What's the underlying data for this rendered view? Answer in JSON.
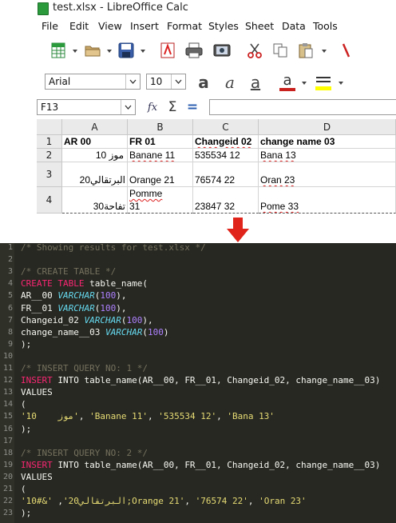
{
  "window": {
    "title": "test.xlsx - LibreOffice Calc"
  },
  "menu": [
    "File",
    "Edit",
    "View",
    "Insert",
    "Format",
    "Styles",
    "Sheet",
    "Data",
    "Tools"
  ],
  "toolbar": {
    "font_name": "Arial",
    "font_size": "10"
  },
  "formula_bar": {
    "cell_ref": "F13",
    "content": ""
  },
  "sheet": {
    "columns": [
      "A",
      "B",
      "C",
      "D"
    ],
    "rows": [
      "1",
      "2",
      "3",
      "4"
    ],
    "cells": {
      "A1": "AR  00",
      "B1": "FR  01",
      "C1": "Changeid 02",
      "D1": "change name  03",
      "A2": "موز  10",
      "B2": "Banane 11",
      "C2": "535534 12",
      "D2": "Bana 13",
      "A3": "البرتقالي20",
      "B3": "Orange 21",
      "C3": "76574 22",
      "D3": "Oran 23",
      "A4": "تفاحة30",
      "B4a": "Pomme",
      "B4b": "31",
      "C4": "23847 32",
      "D4": "Pome 33"
    }
  },
  "arrow_color": "#e0241b",
  "code_lines": [
    [
      {
        "t": "/* Showing results for test.xlsx */",
        "c": "cm"
      }
    ],
    [],
    [
      {
        "t": "/* CREATE TABLE */",
        "c": "cm"
      }
    ],
    [
      {
        "t": "CREATE TABLE",
        "c": "kw"
      },
      {
        "t": " table_name("
      }
    ],
    [
      {
        "t": "AR__00 "
      },
      {
        "t": "VARCHAR",
        "c": "ty"
      },
      {
        "t": "("
      },
      {
        "t": "100",
        "c": "nm"
      },
      {
        "t": "),"
      }
    ],
    [
      {
        "t": "FR__01 "
      },
      {
        "t": "VARCHAR",
        "c": "ty"
      },
      {
        "t": "("
      },
      {
        "t": "100",
        "c": "nm"
      },
      {
        "t": "),"
      }
    ],
    [
      {
        "t": "Changeid_02 "
      },
      {
        "t": "VARCHAR",
        "c": "ty"
      },
      {
        "t": "("
      },
      {
        "t": "100",
        "c": "nm"
      },
      {
        "t": "),"
      }
    ],
    [
      {
        "t": "change_name__03 "
      },
      {
        "t": "VARCHAR",
        "c": "ty"
      },
      {
        "t": "("
      },
      {
        "t": "100",
        "c": "nm"
      },
      {
        "t": ")"
      }
    ],
    [
      {
        "t": ");"
      }
    ],
    [],
    [
      {
        "t": "/* INSERT QUERY NO: 1 */",
        "c": "cm"
      }
    ],
    [
      {
        "t": "INSERT",
        "c": "kw"
      },
      {
        "t": " INTO table_name(AR__00, FR__01, Changeid_02, change_name__03)"
      }
    ],
    [
      {
        "t": "VALUES"
      }
    ],
    [
      {
        "t": "("
      }
    ],
    [
      {
        "t": "'10    موز'",
        "c": "st"
      },
      {
        "t": ", "
      },
      {
        "t": "'Banane 11'",
        "c": "st"
      },
      {
        "t": ", "
      },
      {
        "t": "'535534 12'",
        "c": "st"
      },
      {
        "t": ", "
      },
      {
        "t": "'Bana 13'",
        "c": "st"
      }
    ],
    [
      {
        "t": ");"
      }
    ],
    [],
    [
      {
        "t": "/* INSERT QUERY NO: 2 */",
        "c": "cm"
      }
    ],
    [
      {
        "t": "INSERT",
        "c": "kw"
      },
      {
        "t": " INTO table_name(AR__00, FR__01, Changeid_02, change_name__03)"
      }
    ],
    [
      {
        "t": "VALUES"
      }
    ],
    [
      {
        "t": "("
      }
    ],
    [
      {
        "t": "'10#&'",
        "c": "st"
      },
      {
        "t": " ,"
      },
      {
        "t": "'البرتقالي20;Orange 21'",
        "c": "st"
      },
      {
        "t": ", "
      },
      {
        "t": "'76574 22'",
        "c": "st"
      },
      {
        "t": ", "
      },
      {
        "t": "'Oran 23'",
        "c": "st"
      }
    ],
    [
      {
        "t": ");"
      }
    ]
  ]
}
